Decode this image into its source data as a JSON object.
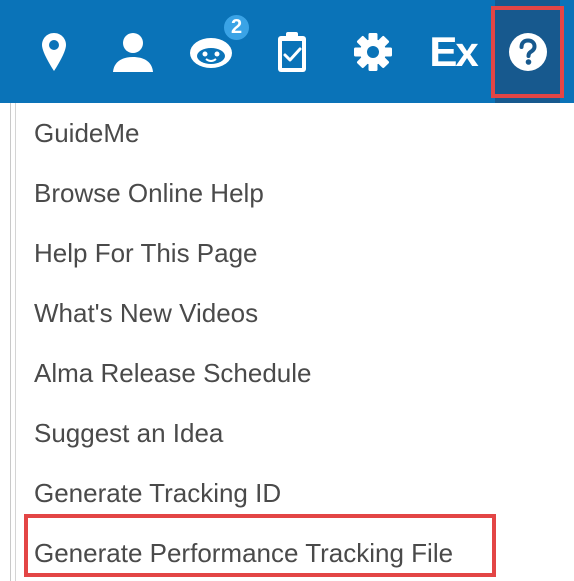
{
  "toolbar": {
    "icons": [
      {
        "name": "location-pin-icon"
      },
      {
        "name": "user-icon"
      },
      {
        "name": "chat-bot-icon",
        "badge": "2"
      },
      {
        "name": "clipboard-check-icon"
      },
      {
        "name": "gear-icon"
      },
      {
        "name": "ex-libris-logo",
        "text": "Ex"
      },
      {
        "name": "help-icon",
        "state": "active"
      }
    ],
    "background_color": "#0a73b8",
    "active_color": "#17598e",
    "highlight_color": "#e34545"
  },
  "help_menu": {
    "items": [
      {
        "label": "GuideMe"
      },
      {
        "label": "Browse Online Help"
      },
      {
        "label": "Help For This Page"
      },
      {
        "label": "What's New Videos"
      },
      {
        "label": "Alma Release Schedule"
      },
      {
        "label": "Suggest an Idea"
      },
      {
        "label": "Generate Tracking ID"
      },
      {
        "label": "Generate Performance Tracking File",
        "highlighted": true
      }
    ]
  }
}
